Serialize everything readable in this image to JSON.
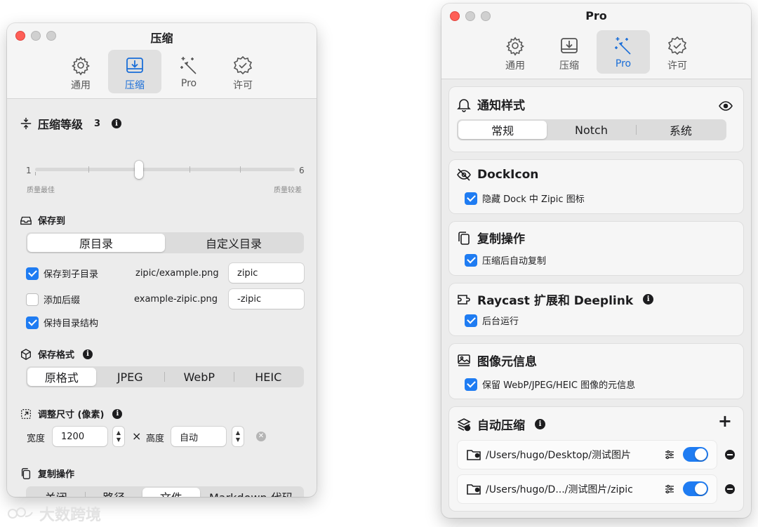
{
  "left_window": {
    "title": "压缩",
    "tabs": [
      {
        "label": "通用",
        "icon": "gear-icon"
      },
      {
        "label": "压缩",
        "icon": "download-tray-icon",
        "selected": true
      },
      {
        "label": "Pro",
        "icon": "magic-wand-icon"
      },
      {
        "label": "许可",
        "icon": "checkmark-seal-icon"
      }
    ],
    "level": {
      "title": "压缩等级",
      "value": "3",
      "min_label": "1",
      "max_label": "6",
      "left_caption": "质量最佳",
      "right_caption": "质量较差",
      "slider_fraction": 0.4
    },
    "save_to": {
      "title": "保存到",
      "options": [
        "原目录",
        "自定义目录"
      ],
      "selected": "原目录",
      "subdir": {
        "label": "保存到子目录",
        "checked": true,
        "example": "zipic/example.png",
        "value": "zipic"
      },
      "suffix": {
        "label": "添加后缀",
        "checked": false,
        "example": "example-zipic.png",
        "value": "-zipic"
      },
      "keep_structure": {
        "label": "保持目录结构",
        "checked": true
      }
    },
    "format": {
      "title": "保存格式",
      "options": [
        "原格式",
        "JPEG",
        "WebP",
        "HEIC"
      ],
      "selected": "原格式"
    },
    "resize": {
      "title": "调整尺寸 (像素)",
      "width_label": "宽度",
      "width_value": "1200",
      "times": "×",
      "height_label": "高度",
      "height_value": "自动"
    },
    "copy": {
      "title": "复制操作",
      "options": [
        "关闭",
        "路径",
        "文件",
        "Markdown 代码"
      ],
      "selected": "文件"
    }
  },
  "right_window": {
    "title": "Pro",
    "tabs": [
      {
        "label": "通用",
        "icon": "gear-icon"
      },
      {
        "label": "压缩",
        "icon": "download-tray-icon"
      },
      {
        "label": "Pro",
        "icon": "magic-wand-icon",
        "selected": true
      },
      {
        "label": "许可",
        "icon": "checkmark-seal-icon"
      }
    ],
    "notify": {
      "title": "通知样式",
      "options": [
        "常规",
        "Notch",
        "系统"
      ],
      "selected": "常规"
    },
    "dock": {
      "title": "DockIcon",
      "check": "隐藏 Dock 中 Zipic 图标",
      "checked": true
    },
    "copy": {
      "title": "复制操作",
      "check": "压缩后自动复制",
      "checked": true
    },
    "raycast": {
      "title": "Raycast 扩展和 Deeplink",
      "check": "后台运行",
      "checked": true
    },
    "metadata": {
      "title": "图像元信息",
      "check": "保留 WebP/JPEG/HEIC 图像的元信息",
      "checked": true
    },
    "auto": {
      "title": "自动压缩",
      "add": "+",
      "paths": [
        {
          "path": "/Users/hugo/Desktop/测试图片",
          "enabled": true
        },
        {
          "path": "/Users/hugo/D.../测试图片/zipic",
          "enabled": true
        }
      ]
    }
  },
  "watermark": "大数跨境"
}
